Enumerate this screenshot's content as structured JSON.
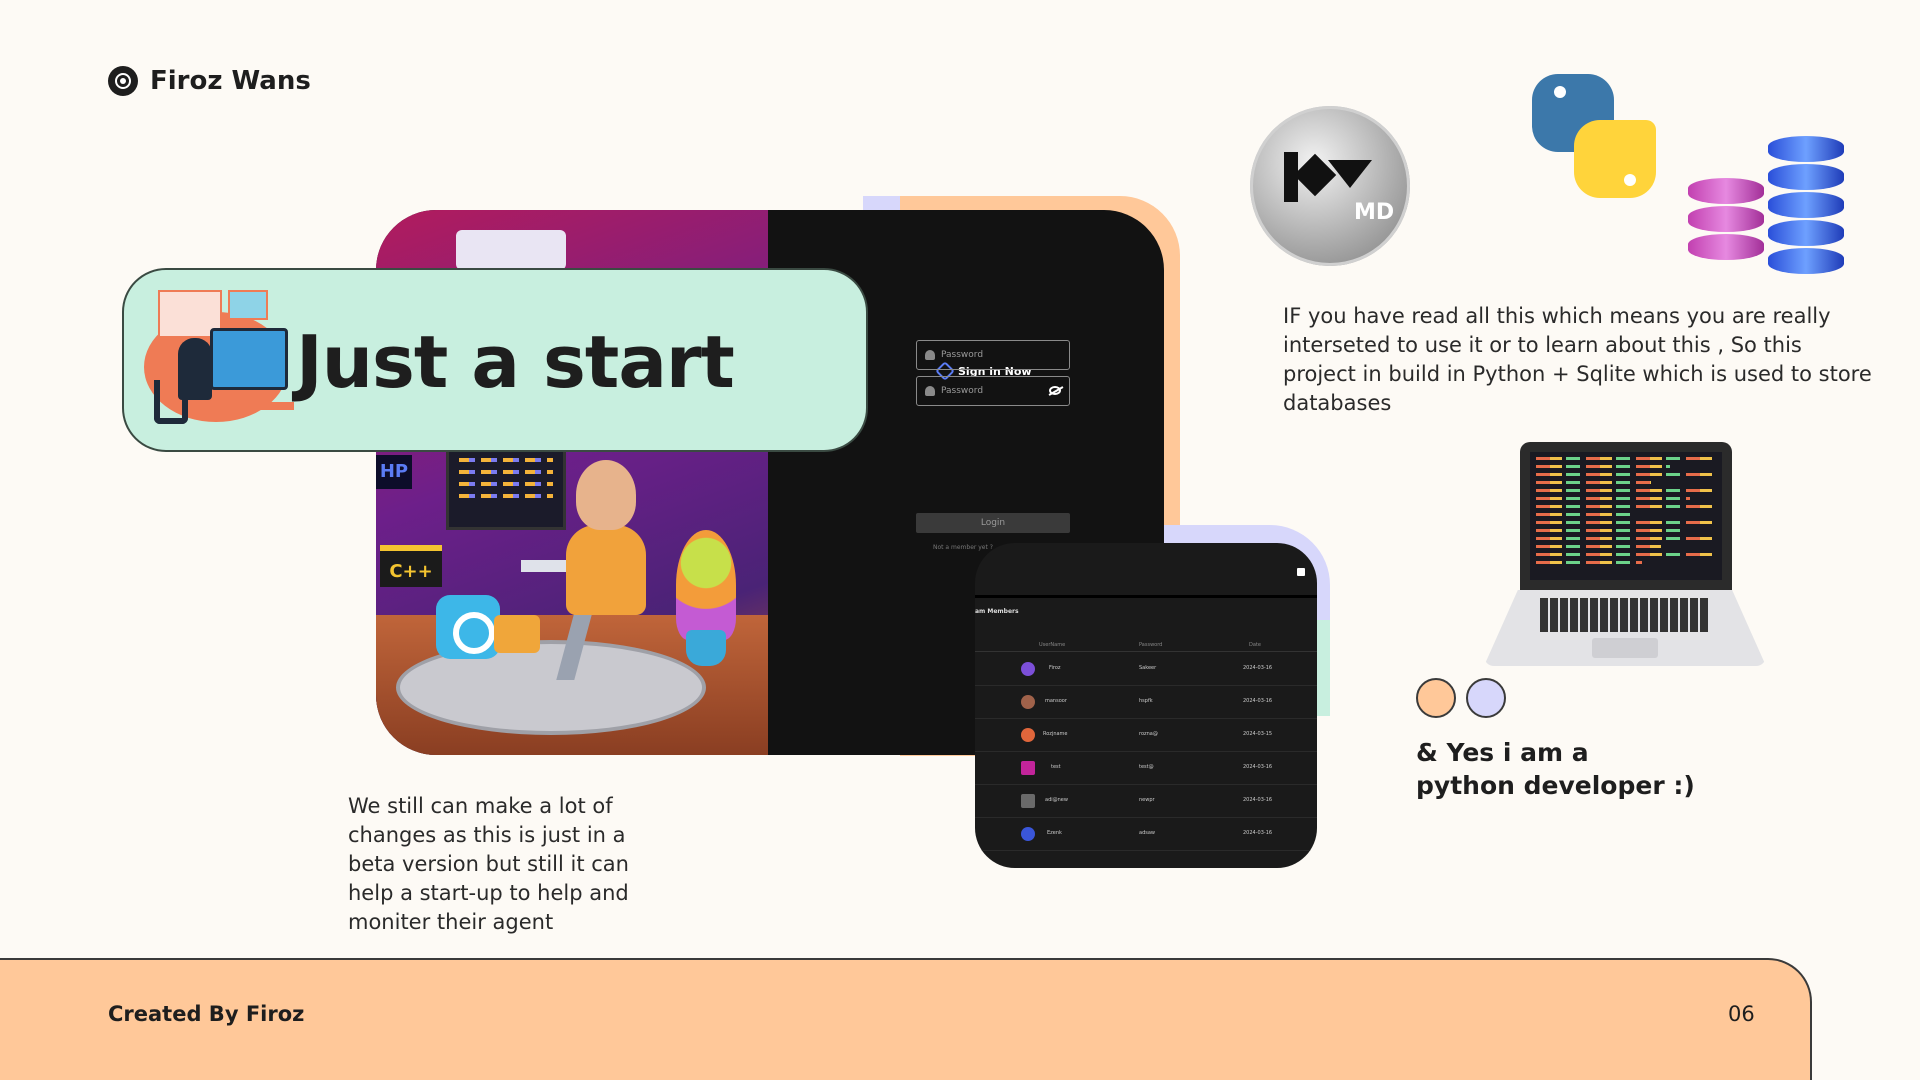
{
  "brand": {
    "name": "Firoz Wans",
    "icon": "target-icon"
  },
  "hero": {
    "title": "Just a start"
  },
  "signin": {
    "title": "Sign in Now",
    "username_placeholder": "Password",
    "password_placeholder": "Password",
    "login_label": "Login",
    "not_member": "Not a member yet ?"
  },
  "scene": {
    "hp_label": "HP",
    "cpp_label": "C++"
  },
  "table_shot": {
    "title": "am Members",
    "headers": [
      "UserName",
      "Password",
      "Date"
    ],
    "rows": [
      [
        "Firoz",
        "Sakeer",
        "2024-03-16"
      ],
      [
        "mansoor",
        "hspfk",
        "2024-03-16"
      ],
      [
        "Rozjname",
        "rozna@",
        "2024-03-15"
      ],
      [
        "test",
        "test@",
        "2024-03-16"
      ],
      [
        "adi@new",
        "newpr",
        "2024-03-16"
      ],
      [
        "Ezenk",
        "adsaw",
        "2024-03-16"
      ]
    ]
  },
  "tech": {
    "kivy_badge": "MD"
  },
  "texts": {
    "right_paragraph": "IF you have read all this which means you are really interseted to use it or to learn about this , So this project in build in Python + Sqlite which is used to store databases",
    "left_paragraph": "We still can make a lot of changes as this is just in a beta version but still it can help a start-up to help and moniter their agent",
    "yes_text": "& Yes i am a python developer :)"
  },
  "footer": {
    "created_by": "Created By Firoz",
    "page_number": "06"
  },
  "colors": {
    "peach": "#ffc899",
    "lavender": "#d7d7fb",
    "mint": "#c8efdf",
    "background": "#fdfaf5"
  }
}
